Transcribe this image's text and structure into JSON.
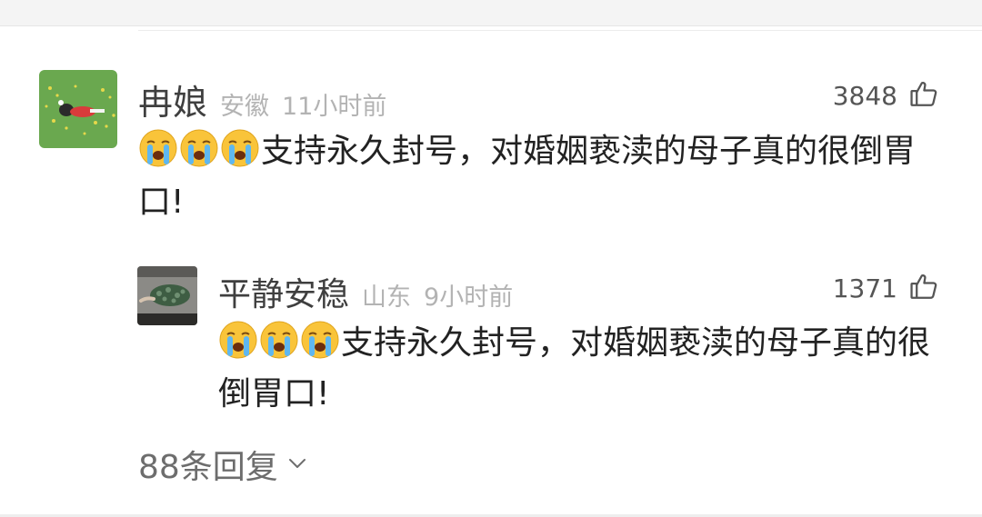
{
  "comment": {
    "username": "冉娘",
    "location": "安徽",
    "time": "11小时前",
    "likes": "3848",
    "text": "支持永久封号，对婚姻亵渎的母子真的很倒胃口!",
    "emoji_count": 3
  },
  "reply": {
    "username": "平静安稳",
    "location": "山东",
    "time": "9小时前",
    "likes": "1371",
    "text": "支持永久封号，对婚姻亵渎的母子真的很倒胃口!",
    "emoji_count": 3
  },
  "replies_link": {
    "label": "88条回复"
  },
  "icons": {
    "emoji": "crying-emoji-icon",
    "like": "thumbs-up-icon",
    "expand": "chevron-down-icon"
  },
  "colors": {
    "username": "#3f3f3f",
    "meta": "#b3b3b3",
    "text": "#222222",
    "replies": "#6d6d6d"
  }
}
